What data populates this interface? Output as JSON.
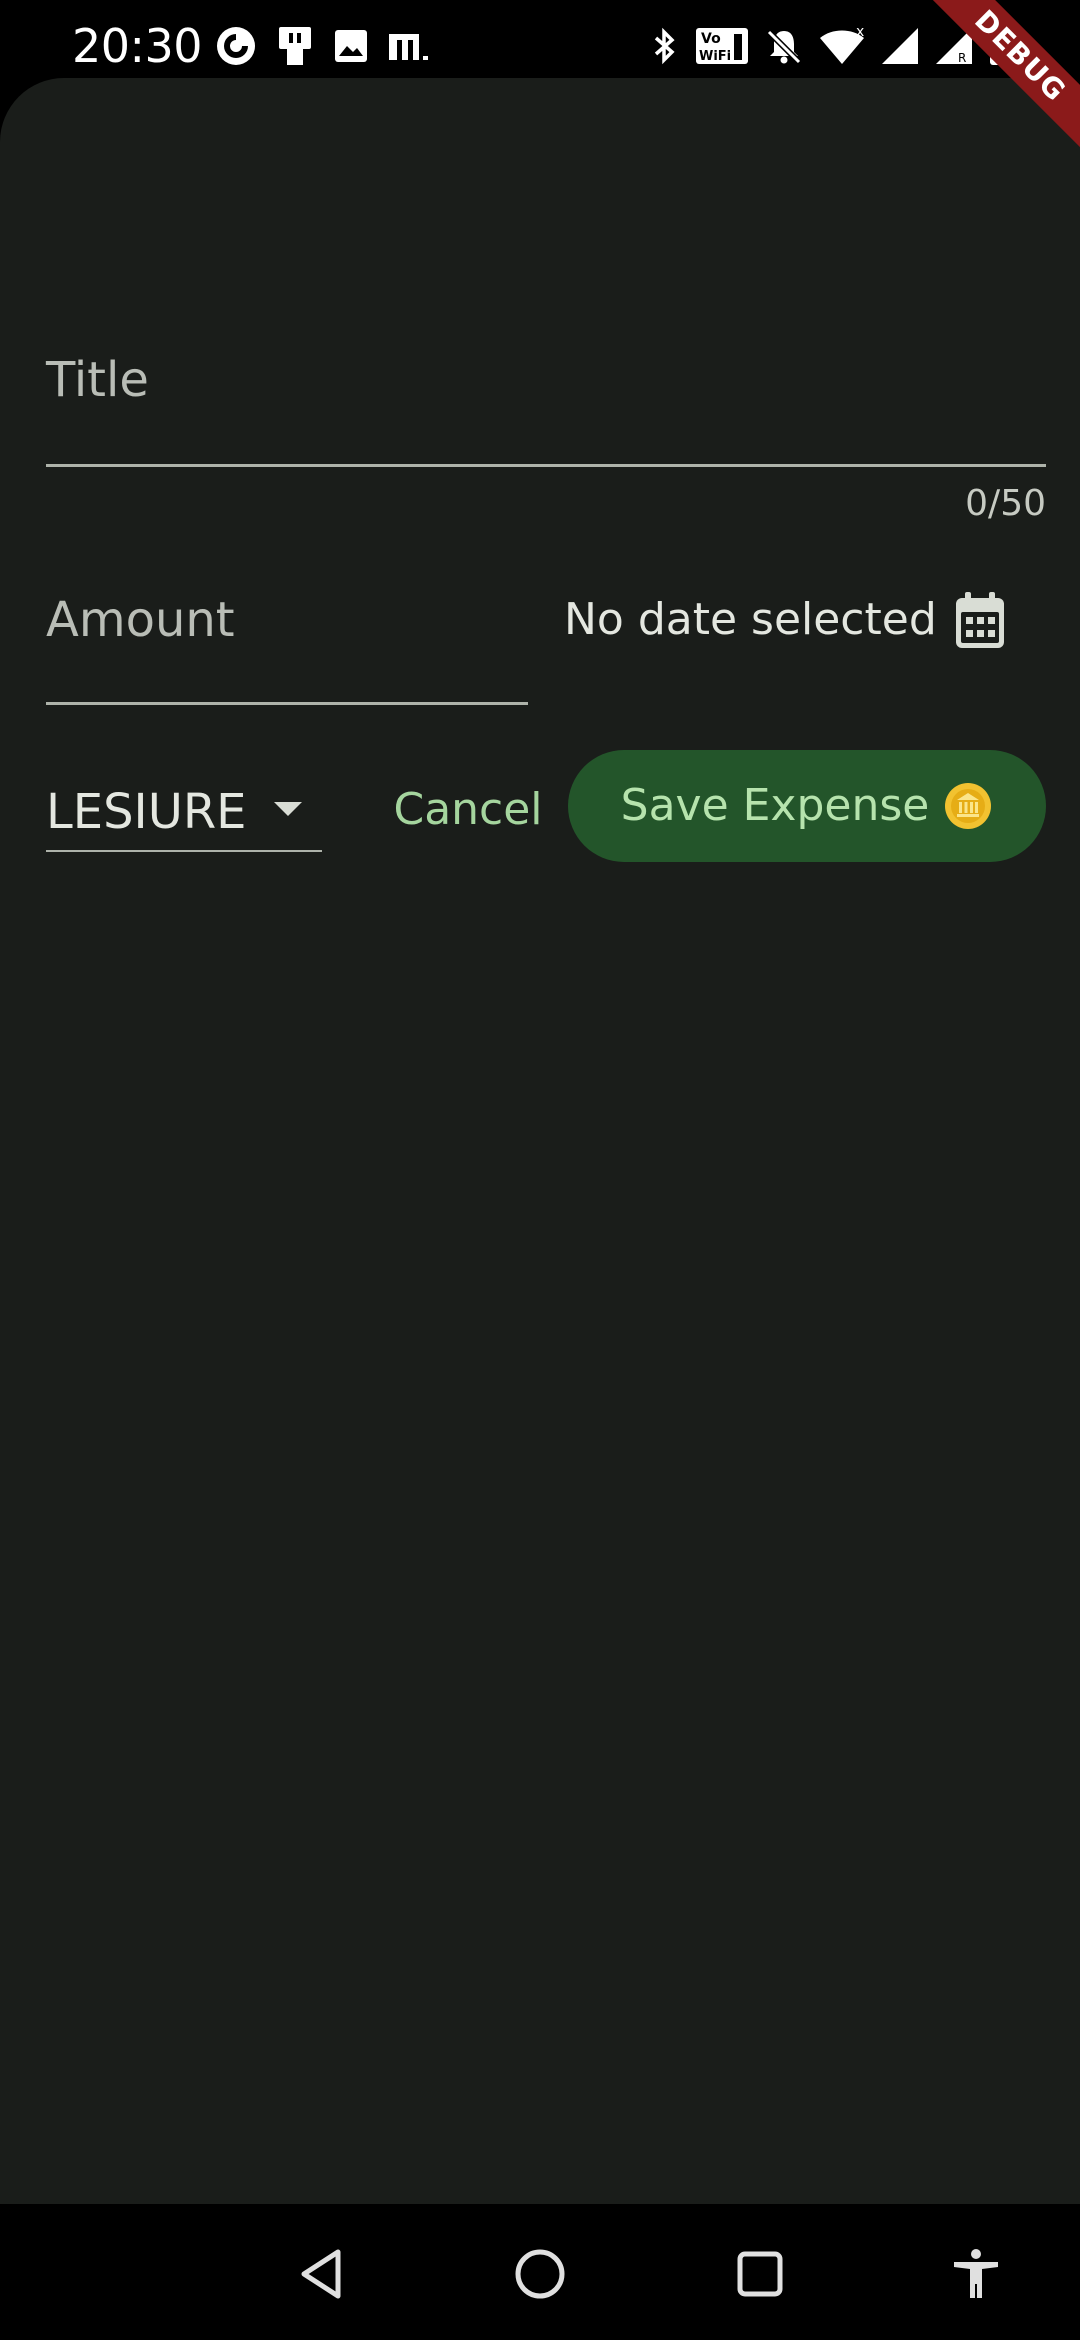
{
  "status_bar": {
    "time": "20:30",
    "left_icons": [
      "pocket-casts-icon",
      "sim-card-icon",
      "image-icon",
      "m-app-icon"
    ],
    "right_icons": [
      "bluetooth-icon",
      "vowifi-icon",
      "notifications-muted-icon",
      "wifi-icon",
      "cell-signal-icon",
      "cell-signal-roaming-icon",
      "battery-icon"
    ]
  },
  "debug_banner": {
    "label": "DEBUG"
  },
  "form": {
    "title": {
      "placeholder": "Title",
      "counter": "0/50"
    },
    "amount": {
      "placeholder": "Amount"
    },
    "date": {
      "label": "No date selected",
      "icon": "calendar-icon"
    },
    "category": {
      "selected": "LESIURE",
      "icon": "dropdown-arrow-icon"
    },
    "actions": {
      "cancel_label": "Cancel",
      "save_label": "Save Expense",
      "save_icon": "coin-icon"
    }
  },
  "nav_bar": {
    "buttons": [
      "back-icon",
      "home-icon",
      "recents-icon",
      "accessibility-icon"
    ]
  },
  "colors": {
    "sheet_background": "#1a1d1a",
    "accent_text": "#a5d59e",
    "save_button": "#23552a",
    "debug_banner": "#8b1a1a"
  }
}
